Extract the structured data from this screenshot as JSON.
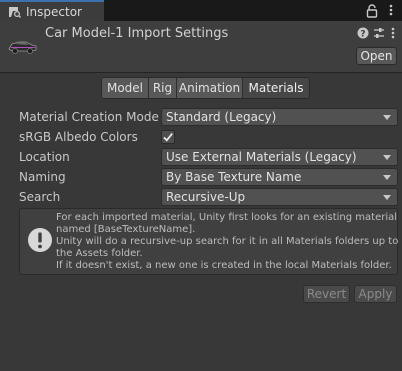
{
  "window": {
    "tab_label": "Inspector",
    "tab_icon": "inspector-icon",
    "lock_icon": "lock-icon",
    "menu_icon": "kebab-menu-icon"
  },
  "header": {
    "title": "Car Model-1 Import Settings",
    "thumbnail_icon": "car-model-thumbnail",
    "help_icon": "help-icon",
    "presets_icon": "presets-sliders-icon",
    "menu_icon": "kebab-menu-icon",
    "open_label": "Open"
  },
  "tabs": [
    {
      "label": "Model",
      "active": false
    },
    {
      "label": "Rig",
      "active": false
    },
    {
      "label": "Animation",
      "active": false
    },
    {
      "label": "Materials",
      "active": true
    }
  ],
  "properties": {
    "material_creation_mode": {
      "label": "Material Creation Mode",
      "value": "Standard (Legacy)"
    },
    "srgb_albedo_colors": {
      "label": "sRGB Albedo Colors",
      "checked": true
    },
    "location": {
      "label": "Location",
      "value": "Use External Materials (Legacy)"
    },
    "naming": {
      "label": "Naming",
      "value": "By Base Texture Name"
    },
    "search": {
      "label": "Search",
      "value": "Recursive-Up"
    }
  },
  "help": {
    "icon": "info-exclamation-icon",
    "lines": [
      "For each imported material, Unity first looks for an existing material",
      "named [BaseTextureName].",
      "Unity will do a recursive-up search for it in all Materials folders up to",
      "the Assets folder.",
      "If it doesn't exist, a new one is created in the local Materials folder."
    ]
  },
  "buttons": {
    "revert_label": "Revert",
    "apply_label": "Apply"
  },
  "colors": {
    "background": "#383838",
    "tab_accent": "#3a72b0",
    "dropdown_bg": "#515151"
  }
}
